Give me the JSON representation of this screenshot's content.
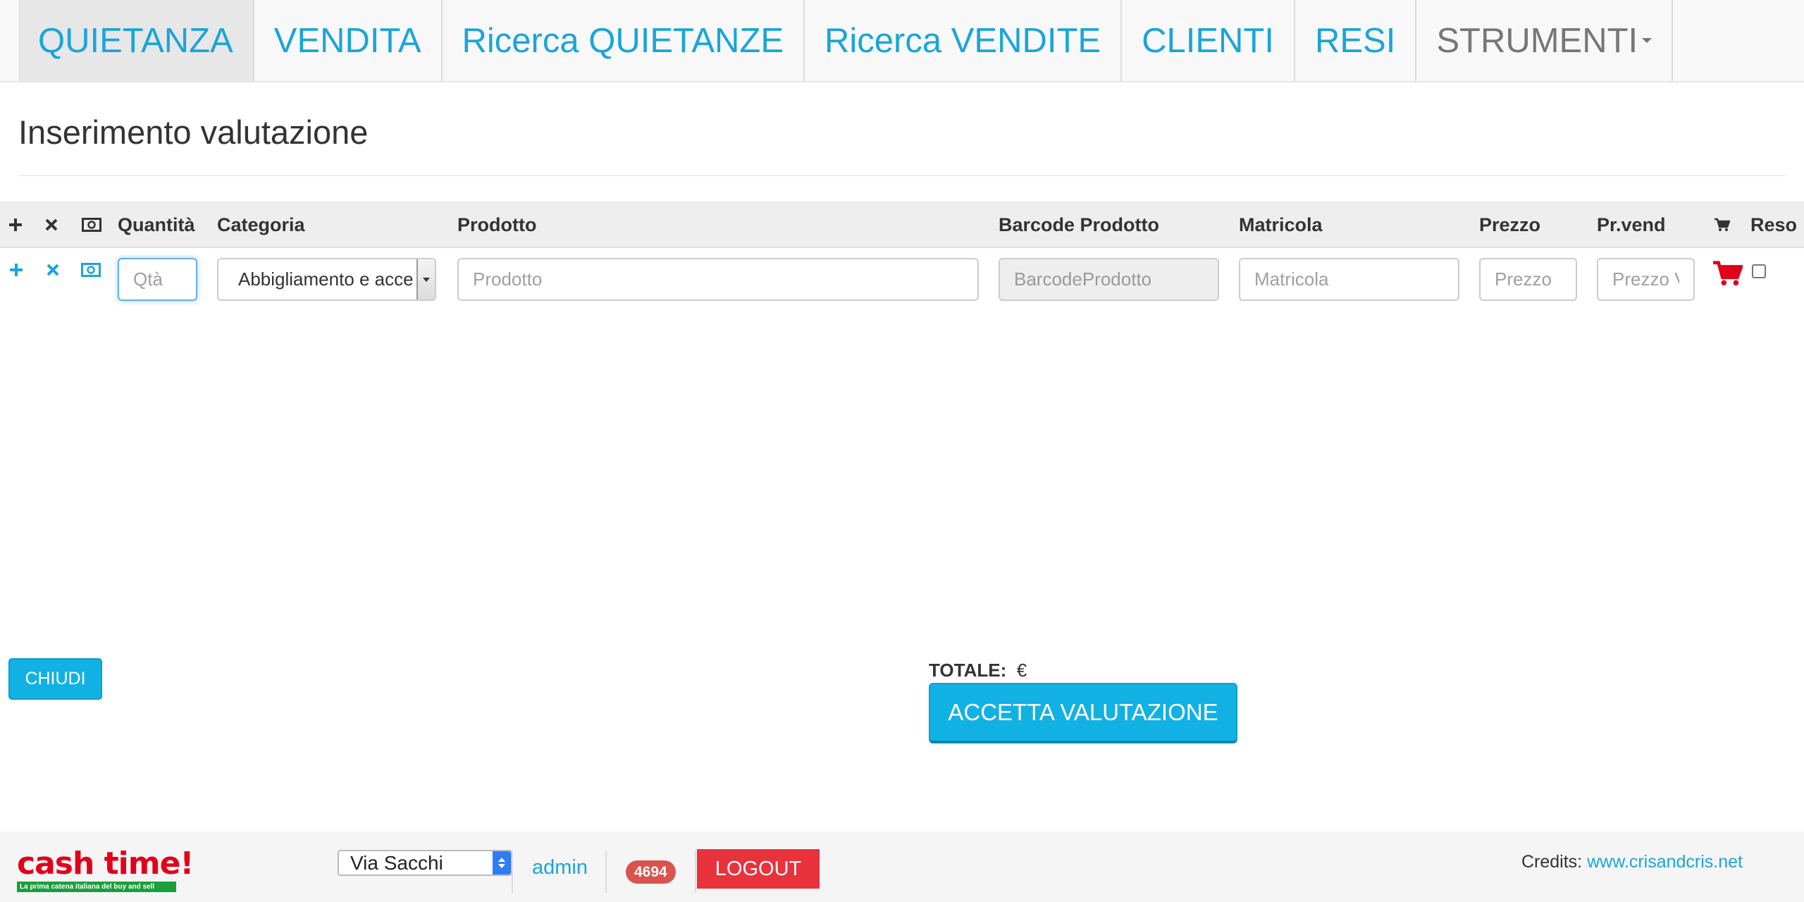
{
  "navbar": {
    "tabs": [
      {
        "label": "QUIETANZA",
        "active": true
      },
      {
        "label": "VENDITA"
      },
      {
        "label": "Ricerca QUIETANZE"
      },
      {
        "label": "Ricerca VENDITE"
      },
      {
        "label": "CLIENTI"
      },
      {
        "label": "RESI"
      },
      {
        "label": "STRUMENTI",
        "dropdown": true
      }
    ]
  },
  "page": {
    "title": "Inserimento valutazione"
  },
  "table": {
    "headers": {
      "add_icon": "plus-icon",
      "remove_icon": "times-icon",
      "money_icon": "money-icon",
      "quantity": "Quantità",
      "category": "Categoria",
      "product": "Prodotto",
      "barcode": "Barcode Prodotto",
      "serial": "Matricola",
      "price": "Prezzo",
      "sale_price": "Pr.vend",
      "cart_icon": "cart-icon",
      "return": "Reso"
    },
    "row": {
      "quantity_placeholder": "Qtà",
      "category_value": "Abbigliamento e accessori",
      "product_placeholder": "Prodotto",
      "barcode_placeholder": "BarcodeProdotto",
      "serial_placeholder": "Matricola",
      "price_placeholder": "Prezzo",
      "sale_price_placeholder": "Prezzo Vendita",
      "return_checked": false
    }
  },
  "actions": {
    "close_label": "CHIUDI",
    "total_label": "TOTALE:",
    "total_currency": "€",
    "accept_label": "ACCETTA VALUTAZIONE"
  },
  "footer": {
    "logo_text": "cash time!",
    "logo_tagline": "La prima catena italiana del buy and sell",
    "store_selected": "Via Sacchi",
    "user": "admin",
    "badge_count": "4694",
    "logout_label": "LOGOUT",
    "credits_label": "Credits:",
    "credits_link": "www.crisandcris.net"
  },
  "colors": {
    "accent": "#1aa5d9",
    "button": "#12b1e3",
    "logout": "#e8323c",
    "cart": "#e0001a",
    "badge": "#d9534f"
  }
}
